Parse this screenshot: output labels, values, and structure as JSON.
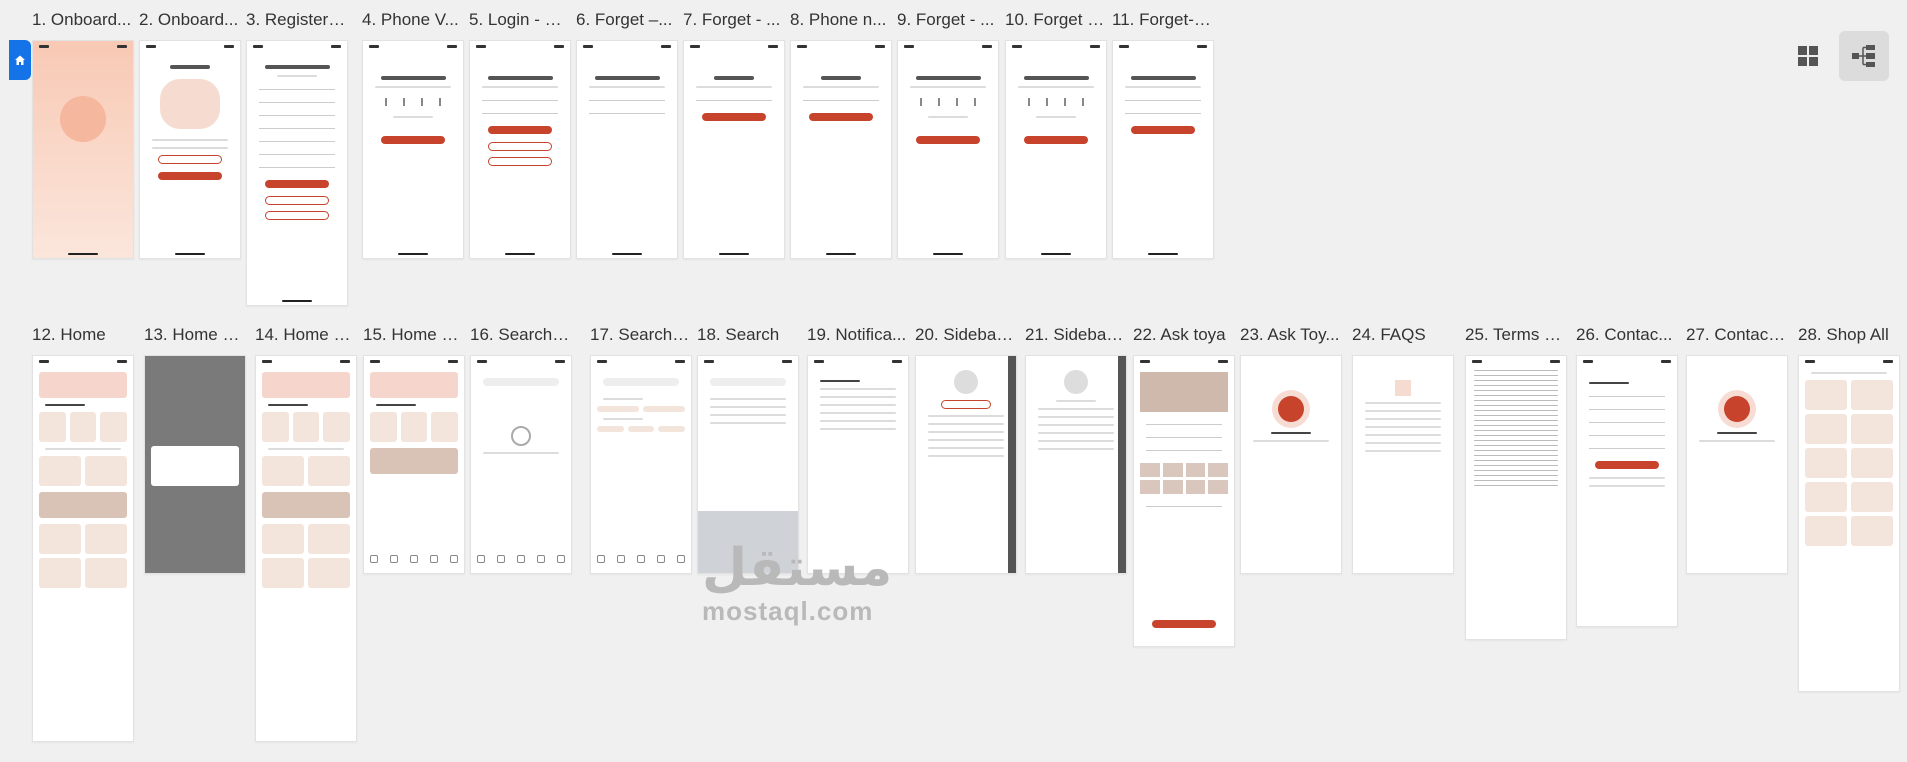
{
  "screens_row1": [
    {
      "label": "1. Onboard..."
    },
    {
      "label": "2. Onboard..."
    },
    {
      "label": "3. Register ..."
    },
    {
      "label": "4. Phone V..."
    },
    {
      "label": "5. Login - E..."
    },
    {
      "label": "6. Forget –..."
    },
    {
      "label": "7. Forget - ..."
    },
    {
      "label": "8. Phone n..."
    },
    {
      "label": "9. Forget - ..."
    },
    {
      "label": "10. Forget -..."
    },
    {
      "label": "11. Forget- ..."
    }
  ],
  "screens_row2": [
    {
      "label": "12. Home"
    },
    {
      "label": "13. Home –..."
    },
    {
      "label": "14. Home - ..."
    },
    {
      "label": "15. Home - ..."
    },
    {
      "label": "16. Search ..."
    },
    {
      "label": "17. Search ..."
    },
    {
      "label": "18. Search"
    },
    {
      "label": "19. Notifica..."
    },
    {
      "label": "20. Sidebar..."
    },
    {
      "label": "21. Sidebar ..."
    },
    {
      "label": "22. Ask toya"
    },
    {
      "label": "23. Ask Toy..."
    },
    {
      "label": "24. FAQS"
    },
    {
      "label": "25. Terms a..."
    },
    {
      "label": "26. Contac..."
    },
    {
      "label": "27. Contact..."
    },
    {
      "label": "28. Shop All"
    }
  ],
  "icons": {
    "home": "home-icon",
    "grid_view": "grid-view-icon",
    "flow_view": "flow-view-icon"
  },
  "watermark": {
    "arabic": "مستقل",
    "latin": "mostaql.com"
  },
  "colors": {
    "accent": "#c8432b",
    "brand_blue": "#1473e6"
  }
}
